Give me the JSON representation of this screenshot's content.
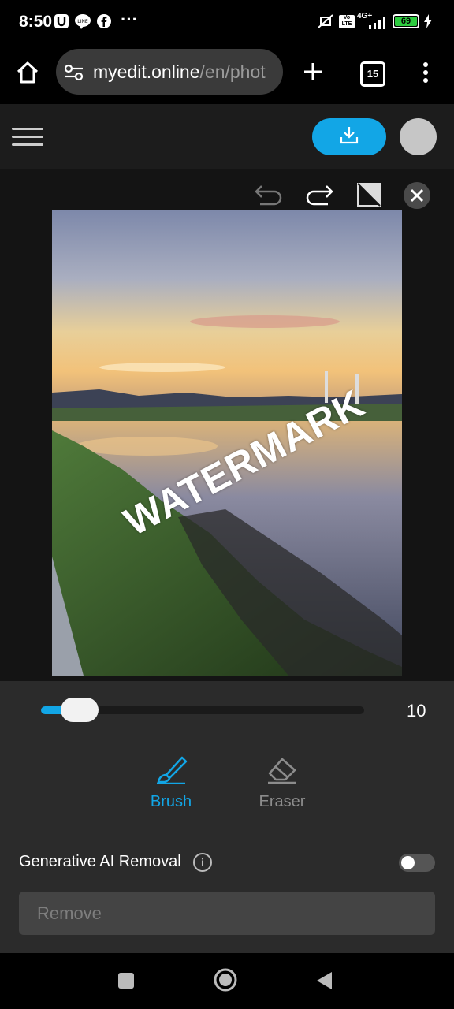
{
  "status_bar": {
    "time": "8:50",
    "battery": "69",
    "network_label": "4G+",
    "volte_label": "Vo LTE",
    "more": "···"
  },
  "browser": {
    "url_host": "myedit.online",
    "url_path": "/en/phot",
    "tab_count": "15"
  },
  "editor": {
    "watermark_text": "WATERMARK",
    "brush_size": "10",
    "brush_size_fraction": 0.1,
    "tools": [
      {
        "label": "Brush",
        "active": true
      },
      {
        "label": "Eraser",
        "active": false
      }
    ],
    "generative_ai_label": "Generative AI Removal",
    "generative_ai_enabled": false,
    "remove_label": "Remove",
    "accent_color": "#12a6e6"
  },
  "icons": {
    "status": [
      "u-app-icon",
      "line-icon",
      "facebook-icon",
      "mute-icon",
      "signal-icon",
      "charging-icon"
    ],
    "browser": [
      "home-icon",
      "site-settings-icon",
      "new-tab-icon",
      "tab-switcher-icon",
      "more-menu-icon"
    ],
    "editor": [
      "menu-icon",
      "download-icon",
      "undo-icon",
      "redo-icon",
      "compare-icon",
      "close-icon",
      "brush-icon",
      "eraser-icon",
      "info-icon"
    ],
    "nav": [
      "recents-icon",
      "home-nav-icon",
      "back-icon"
    ]
  }
}
